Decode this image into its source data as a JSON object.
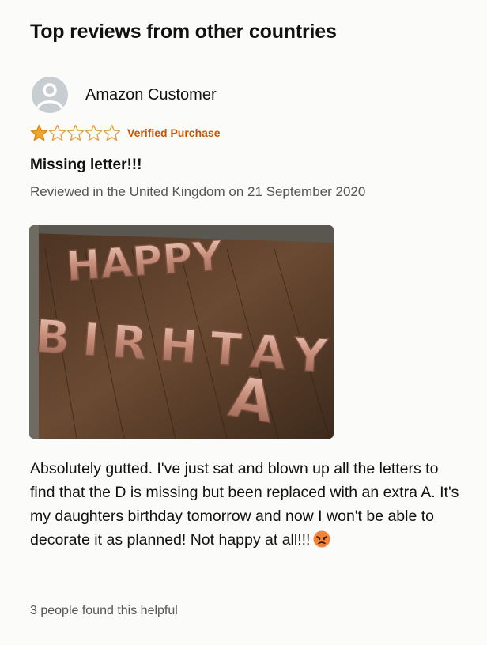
{
  "section": {
    "title": "Top reviews from other countries"
  },
  "review": {
    "author": "Amazon Customer",
    "rating": 1,
    "rating_max": 5,
    "verified_label": "Verified Purchase",
    "title": "Missing letter!!!",
    "meta": "Reviewed in the United Kingdom on 21 September 2020",
    "photo": {
      "balloon_line1": "HAPPY",
      "balloon_line2": "BIRHTAY",
      "balloon_line3": "A"
    },
    "body": "Absolutely gutted. I've just sat and blown up all the letters to find that the D is missing but been replaced with an extra A. It's my daughters birthday tomorrow and now I won't be able to decorate it as planned! Not happy at all!!!",
    "emoji": "angry-face-icon",
    "helpful": "3 people found this helpful"
  },
  "colors": {
    "star_filled": "#f0a42b",
    "star_empty": "#e0a24a",
    "verified": "#c45500",
    "meta": "#555555"
  }
}
